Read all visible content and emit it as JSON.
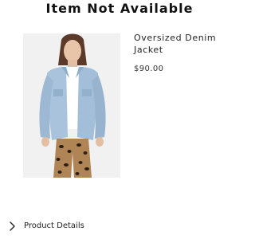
{
  "header": {
    "title": "Item Not Available"
  },
  "product": {
    "name": "Oversized Denim Jacket",
    "price": "$90.00",
    "image_icon": "product-photo"
  },
  "details": {
    "label": "Product Details",
    "icon": "chevron-right-icon"
  },
  "colors": {
    "text": "#111111",
    "image_background": "#f1f1f1",
    "denim": "#a9c3dc",
    "leopard_base": "#b08555"
  }
}
